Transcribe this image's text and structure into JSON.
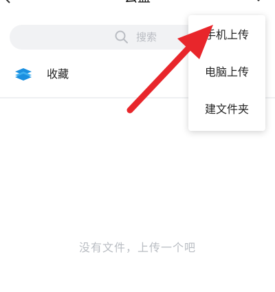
{
  "header": {
    "title": "云盘"
  },
  "search": {
    "placeholder": "搜索",
    "icon": "search-icon"
  },
  "favorites": {
    "label": "收藏",
    "icon": "folder-stack-icon",
    "icon_color": "#1a8fe0"
  },
  "empty_state": {
    "text": "没有文件，上传一个吧"
  },
  "upload_menu": {
    "items": [
      {
        "label": "手机上传"
      },
      {
        "label": "电脑上传"
      },
      {
        "label": "建文件夹"
      }
    ]
  },
  "annotation": {
    "type": "arrow",
    "color": "#e8262b"
  }
}
